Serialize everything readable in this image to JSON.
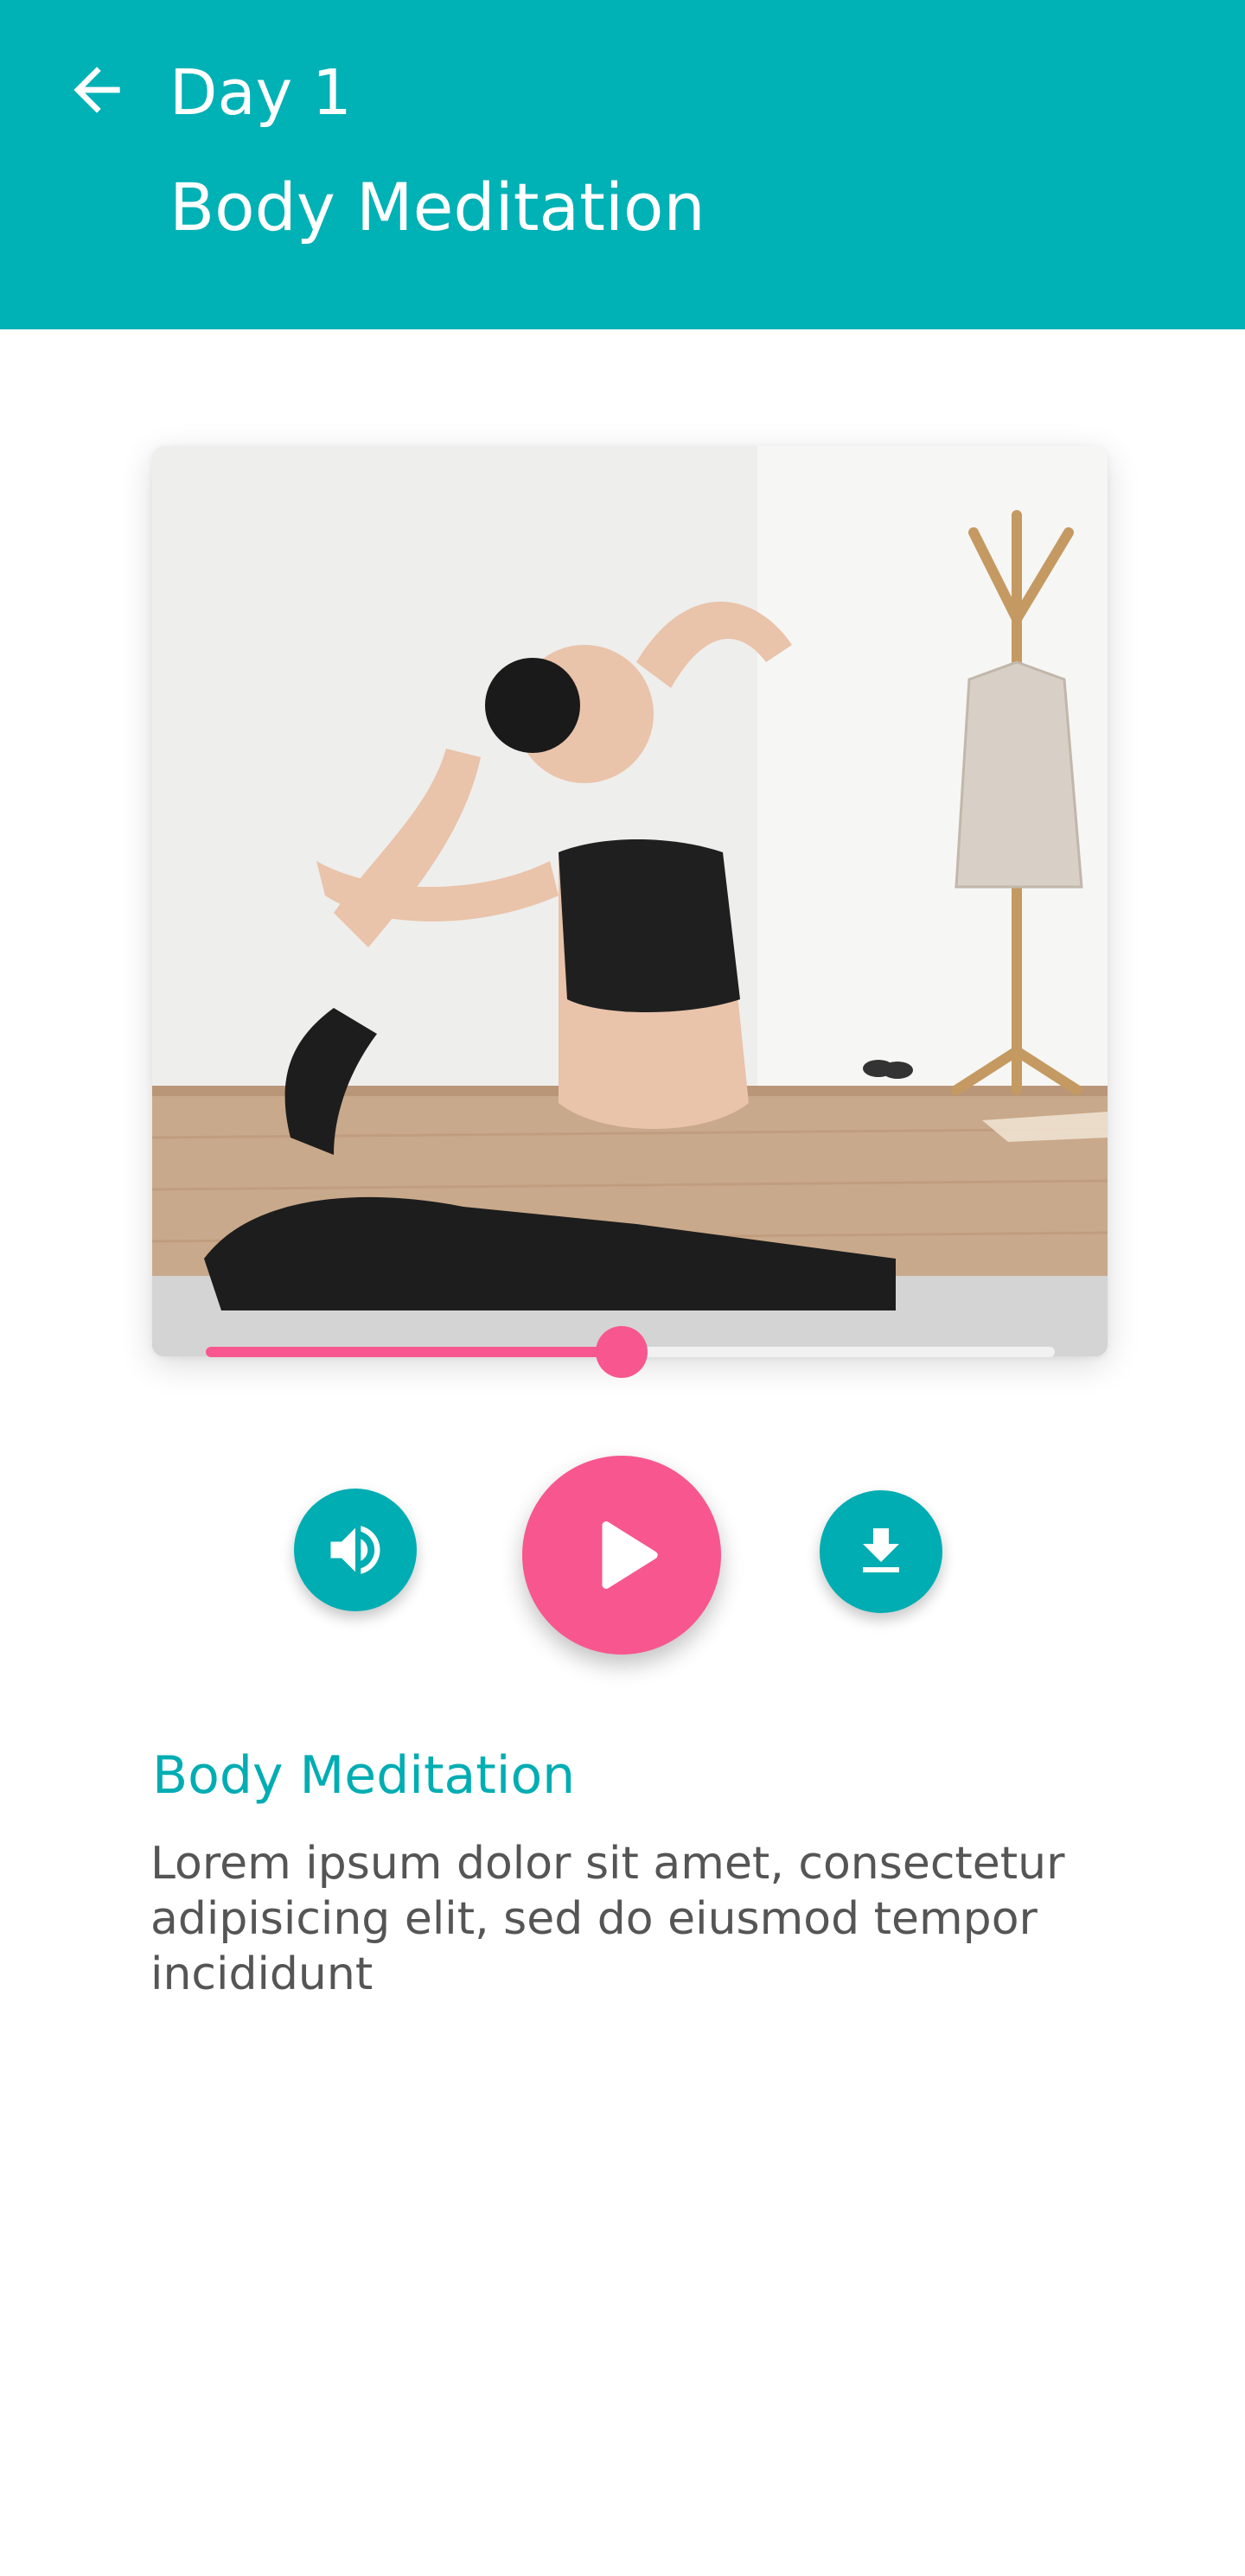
{
  "header": {
    "day_title": "Day 1",
    "subtitle": "Body Meditation",
    "back_icon": "arrow-left-icon",
    "background_color": "#00b1b5"
  },
  "player": {
    "progress_percent": 49,
    "progress_color": "#f7578e",
    "controls": {
      "volume_icon": "volume-up-icon",
      "play_icon": "play-icon",
      "download_icon": "download-icon"
    },
    "accent_color": "#00adb2"
  },
  "track": {
    "title": "Body Meditation",
    "description": "Lorem ipsum dolor sit amet, consectetur adipisicing elit, sed do eiusmod tempor incididunt"
  }
}
